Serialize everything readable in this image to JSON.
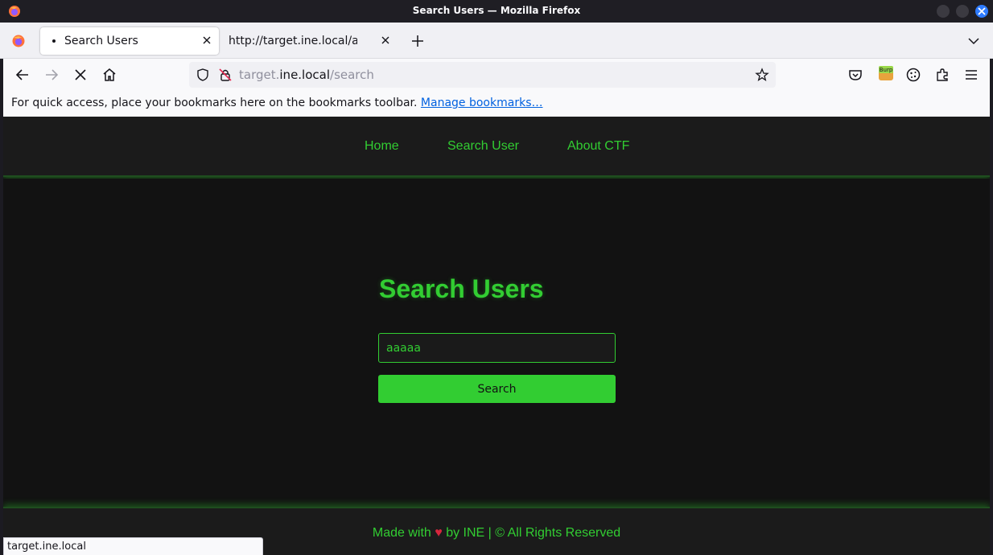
{
  "window": {
    "title": "Search Users — Mozilla Firefox"
  },
  "tabs": [
    {
      "label": "Search Users",
      "active": true
    },
    {
      "label": "http://target.ine.local/about-ctf",
      "active": false
    }
  ],
  "urlbar": {
    "prefix": "target.",
    "host": "ine.local",
    "path": "/search"
  },
  "bookmarks_bar": {
    "message": "For quick access, place your bookmarks here on the bookmarks toolbar.",
    "link": "Manage bookmarks…"
  },
  "site": {
    "nav": [
      "Home",
      "Search User",
      "About CTF"
    ],
    "heading": "Search Users",
    "search_value": "aaaaa",
    "search_button": "Search",
    "footer_before": "Made with",
    "footer_heart": "♥",
    "footer_after": "by INE | © All Rights Reserved"
  },
  "statusbar": {
    "text": "target.ine.local"
  },
  "icons": {
    "app": "firefox-icon",
    "accent": "#32cd32",
    "burp_extension": "Burp"
  }
}
